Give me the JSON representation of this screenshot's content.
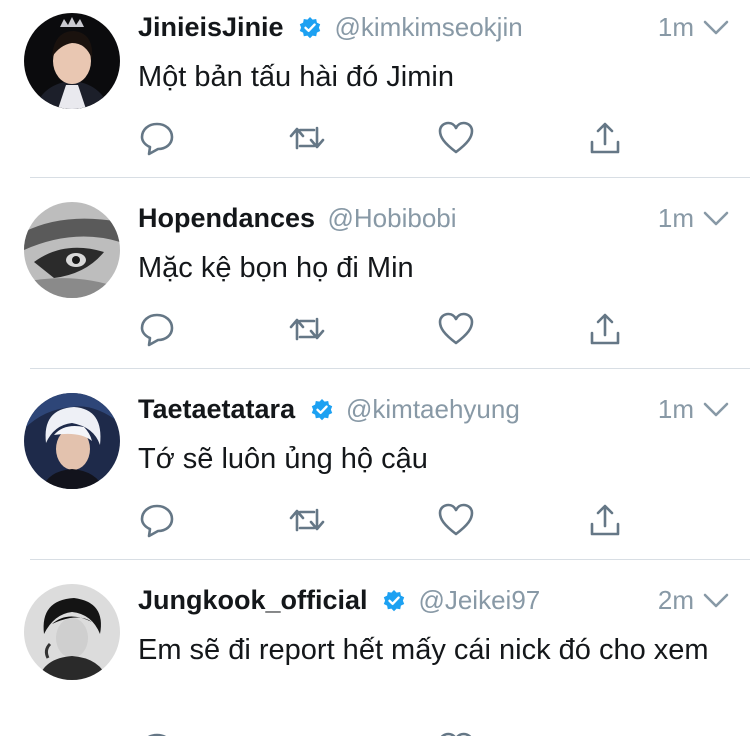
{
  "colors": {
    "verified": "#1da1f2",
    "secondary_text": "#8899a6",
    "primary_text": "#14171a",
    "icon": "#657786",
    "divider": "#d8dee4"
  },
  "icons": {
    "reply": "reply-icon",
    "retweet": "retweet-icon",
    "like": "heart-icon",
    "share": "share-icon",
    "menu": "chevron-down-icon",
    "verified": "verified-badge-icon"
  },
  "tweets": [
    {
      "name": "JinieisJinie",
      "verified": true,
      "handle": "@kimkimseokjin",
      "time": "1m",
      "text": "Một bản tấu hài đó Jimin"
    },
    {
      "name": "Hopendances",
      "verified": false,
      "handle": "@Hobibobi",
      "time": "1m",
      "text": "Mặc kệ bọn họ đi Min"
    },
    {
      "name": "Taetaetatara",
      "verified": true,
      "handle": "@kimtaehyung",
      "time": "1m",
      "text": "Tớ sẽ luôn ủng hộ cậu"
    },
    {
      "name": "Jungkook_official",
      "verified": true,
      "handle": "@Jeikei97",
      "time": "2m",
      "text": "Em sẽ đi report hết mấy cái nick đó cho xem"
    }
  ]
}
